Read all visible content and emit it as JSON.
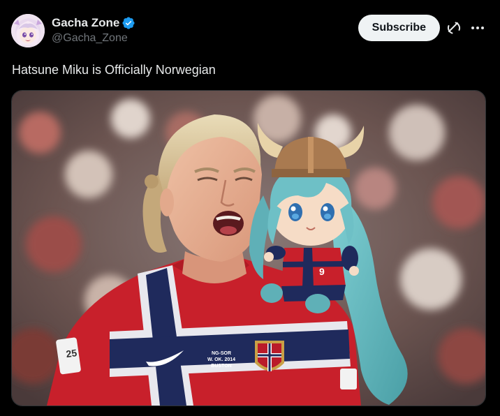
{
  "author": {
    "display_name": "Gacha Zone",
    "handle": "@Gacha_Zone",
    "verified": true,
    "avatar_icon": "anime-girl-avatar"
  },
  "actions": {
    "subscribe_label": "Subscribe",
    "grok_icon": "grok-icon",
    "more_icon": "more-dots-icon"
  },
  "tweet": {
    "text": "Hatsune Miku is Officially Norwegian"
  },
  "media": {
    "jersey_number": "9",
    "match_patch_line1": "NG-SOR",
    "match_patch_line2": "W. OK. 2014",
    "match_patch_line3": "BUSTON"
  },
  "colors": {
    "background": "#000000",
    "text_primary": "#e7e9ea",
    "text_secondary": "#71767b",
    "verified_blue": "#1d9bf0",
    "button_bg": "#eff3f4",
    "jersey_red": "#c8202b",
    "jersey_navy": "#1f2a5c",
    "miku_teal": "#62b8be"
  }
}
